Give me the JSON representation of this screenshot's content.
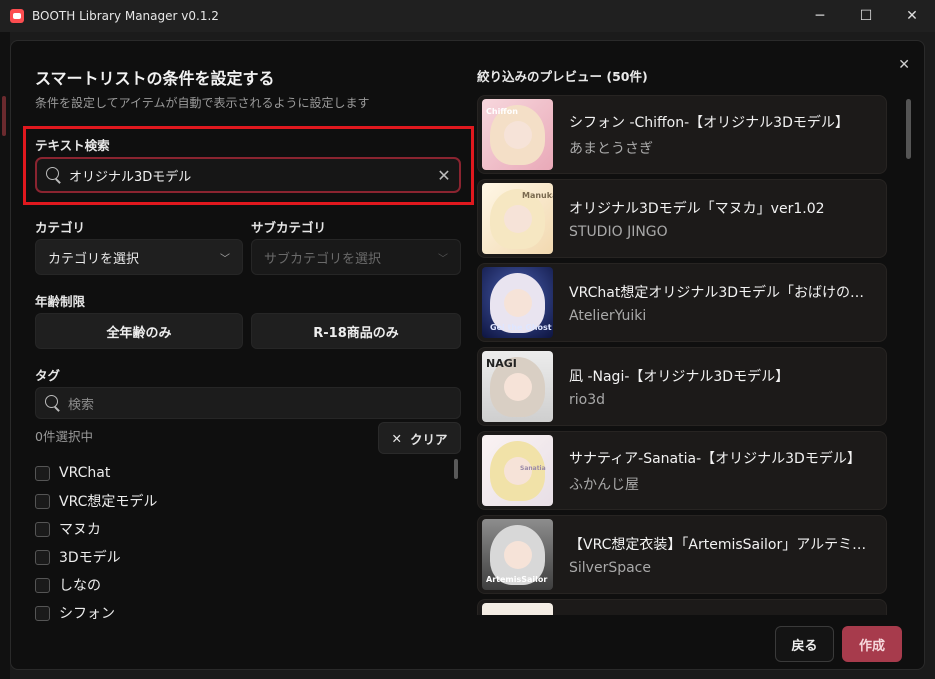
{
  "window": {
    "title": "BOOTH Library Manager v0.1.2",
    "controls": [
      "─",
      "☐",
      "✕"
    ]
  },
  "form": {
    "heading": "スマートリストの条件を設定する",
    "subheading": "条件を設定してアイテムが自動で表示されるように設定します",
    "text_search": {
      "label": "テキスト検索",
      "value": "オリジナル3Dモデル"
    },
    "category": {
      "label": "カテゴリ",
      "value": "カテゴリを選択"
    },
    "subcategory": {
      "label": "サブカテゴリ",
      "value": "サブカテゴリを選択"
    },
    "age": {
      "label": "年齢制限",
      "all_ages": "全年齢のみ",
      "r18": "R-18商品のみ"
    },
    "tags": {
      "label": "タグ",
      "search_placeholder": "検索",
      "selected_count": "0件選択中",
      "clear_label": "クリア",
      "items": [
        "VRChat",
        "VRC想定モデル",
        "マヌカ",
        "3Dモデル",
        "しなの",
        "シフォン"
      ]
    }
  },
  "preview": {
    "title": "絞り込みのプレビュー (50件)",
    "items": [
      {
        "name": "シフォン -Chiffon-【オリジナル3Dモデル】",
        "shop": "あまとうさぎ"
      },
      {
        "name": "オリジナル3Dモデル「マヌカ」ver1.02",
        "shop": "STUDIO JINGO"
      },
      {
        "name": "VRChat想定オリジナル3Dモデル「おばけのギ…",
        "shop": "AtelierYuiki"
      },
      {
        "name": "凪 -Nagi-【オリジナル3Dモデル】",
        "shop": "rio3d"
      },
      {
        "name": "サナティア-Sanatia-【オリジナル3Dモデル】",
        "shop": "ふかんじ屋"
      },
      {
        "name": "【VRC想定衣装】「ArtemisSailor」アルテミス…",
        "shop": "SilverSpace"
      }
    ],
    "thumb_captions": [
      "Chiffon",
      "Manuka",
      "Gei the Ghost",
      "NAGI",
      "Sanatia",
      "ArtemisSailor"
    ]
  },
  "footer": {
    "back": "戻る",
    "create": "作成"
  },
  "colors": {
    "accent": "#a73b4c",
    "highlight": "#e0181e",
    "focus": "#8a2430"
  }
}
